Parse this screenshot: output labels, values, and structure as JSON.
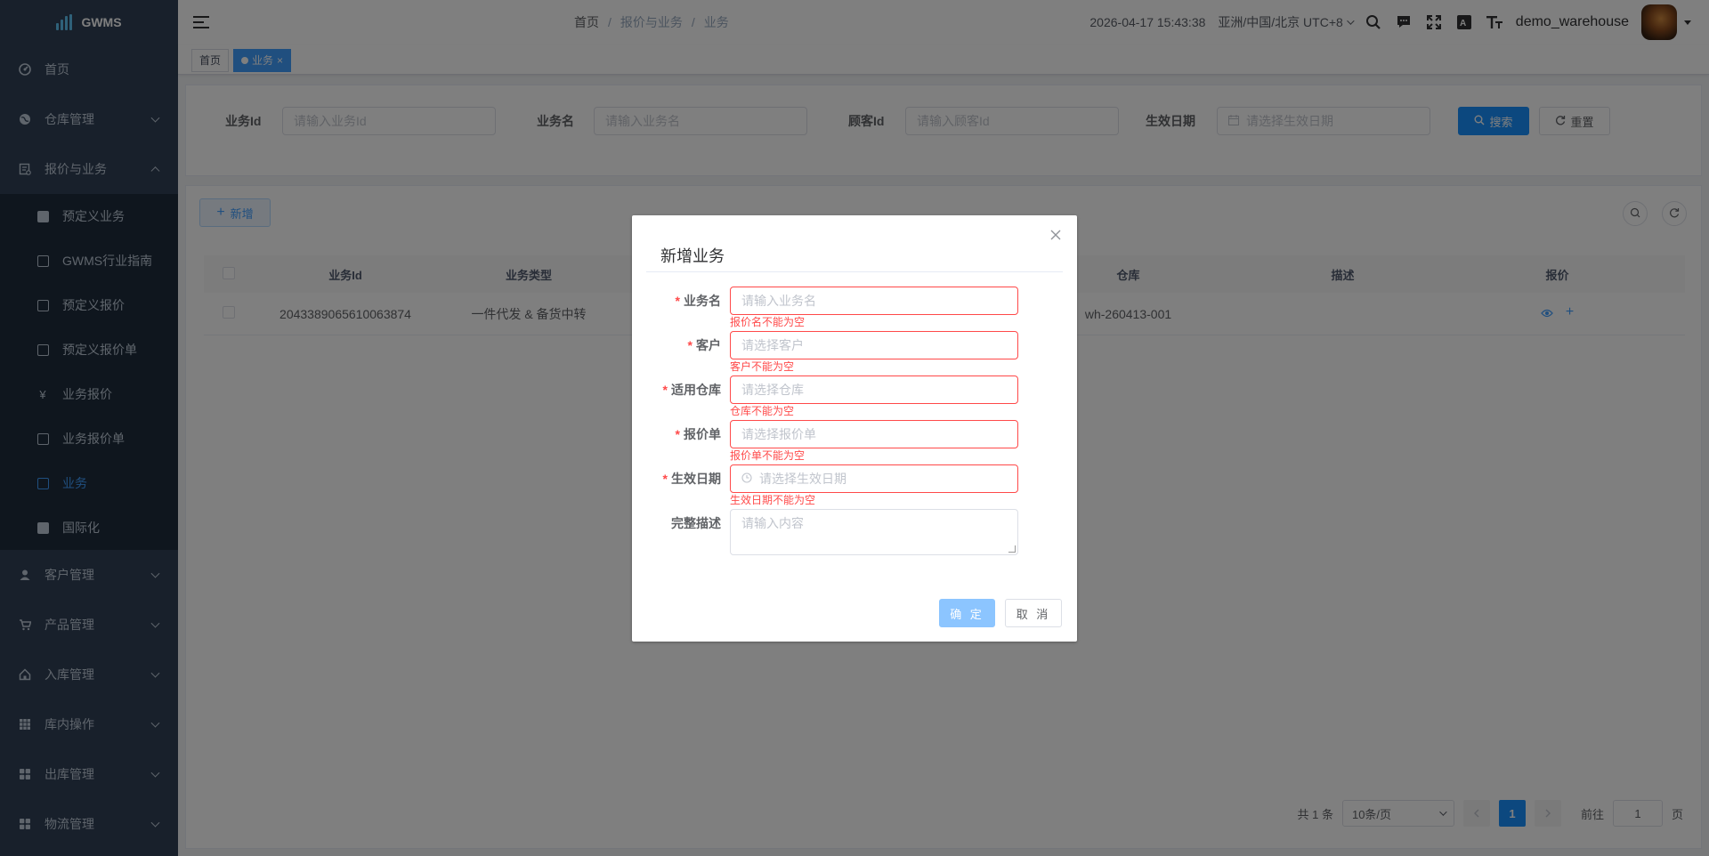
{
  "app": {
    "name": "GWMS"
  },
  "sidebar": {
    "items": [
      {
        "label": "首页",
        "icon": "dashboard-icon"
      },
      {
        "label": "仓库管理",
        "icon": "globe-icon"
      },
      {
        "label": "报价与业务",
        "icon": "quote-icon"
      }
    ],
    "sub_items": [
      {
        "label": "预定义业务",
        "icon": "document-icon"
      },
      {
        "label": "GWMS行业指南",
        "icon": "guide-icon"
      },
      {
        "label": "预定义报价",
        "icon": "quote-icon"
      },
      {
        "label": "预定义报价单",
        "icon": "edit-icon"
      },
      {
        "label": "业务报价",
        "icon": "yen-icon"
      },
      {
        "label": "业务报价单",
        "icon": "edit-icon"
      },
      {
        "label": "业务",
        "icon": "business-icon"
      },
      {
        "label": "国际化",
        "icon": "language-icon"
      }
    ],
    "items_after": [
      {
        "label": "客户管理",
        "icon": "user-icon"
      },
      {
        "label": "产品管理",
        "icon": "cart-icon"
      },
      {
        "label": "入库管理",
        "icon": "home-icon"
      },
      {
        "label": "库内操作",
        "icon": "grid-icon"
      },
      {
        "label": "出库管理",
        "icon": "apps-icon"
      },
      {
        "label": "物流管理",
        "icon": "apps-icon"
      }
    ]
  },
  "navbar": {
    "breadcrumb": [
      "首页",
      "报价与业务",
      "业务"
    ],
    "breadcrumb_sep": "/",
    "datetime": "2026-04-17 15:43:38",
    "timezone": "亚洲/中国/北京 UTC+8",
    "username": "demo_warehouse"
  },
  "tags": {
    "home": "首页",
    "active": "业务",
    "close": "×"
  },
  "search": {
    "fields": [
      {
        "label": "业务Id",
        "placeholder": "请输入业务Id"
      },
      {
        "label": "业务名",
        "placeholder": "请输入业务名"
      },
      {
        "label": "顾客Id",
        "placeholder": "请输入顾客Id"
      },
      {
        "label": "生效日期",
        "placeholder": "请选择生效日期"
      }
    ],
    "search_button": "搜索",
    "reset_button": "重置"
  },
  "toolbar": {
    "add_button": "新增"
  },
  "table": {
    "columns": [
      "业务Id",
      "业务类型",
      "仓库",
      "描述",
      "报价"
    ],
    "rows": [
      {
        "id": "2043389065610063874",
        "type": "一件代发 & 备货中转",
        "warehouse": "wh-260413-001",
        "desc": ""
      }
    ]
  },
  "pagination": {
    "total": "共 1 条",
    "page_size": "10条/页",
    "current": "1",
    "goto_label": "前往",
    "goto_value": "1",
    "page_unit": "页"
  },
  "dialog": {
    "title": "新增业务",
    "fields": [
      {
        "label": "业务名",
        "placeholder": "请输入业务名",
        "error": "报价名不能为空",
        "required": true
      },
      {
        "label": "客户",
        "placeholder": "请选择客户",
        "error": "客户不能为空",
        "required": true
      },
      {
        "label": "适用仓库",
        "placeholder": "请选择仓库",
        "error": "仓库不能为空",
        "required": true
      },
      {
        "label": "报价单",
        "placeholder": "请选择报价单",
        "error": "报价单不能为空",
        "required": true
      },
      {
        "label": "生效日期",
        "placeholder": "请选择生效日期",
        "error": "生效日期不能为空",
        "required": true
      }
    ],
    "desc_label": "完整描述",
    "desc_placeholder": "请输入内容",
    "required_mark": "*",
    "ok_button": "确 定",
    "cancel_button": "取 消"
  },
  "colors": {
    "primary": "#1890ff",
    "sidebar_bg": "#304156",
    "submenu_bg": "#1f2d3d",
    "error": "#ff4949",
    "active_menu": "#409eff"
  }
}
